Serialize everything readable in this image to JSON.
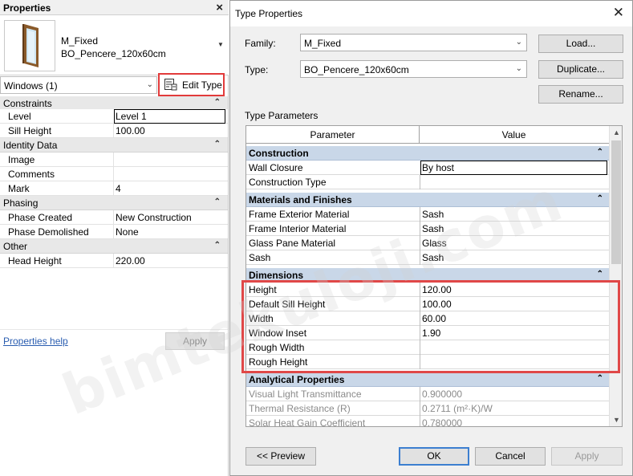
{
  "properties_panel": {
    "title": "Properties",
    "type_selector": {
      "family": "M_Fixed",
      "type": "BO_Pencere_120x60cm"
    },
    "instance_filter": "Windows (1)",
    "edit_type_label": "Edit Type",
    "rows": [
      {
        "kind": "group",
        "label": "Constraints"
      },
      {
        "kind": "param",
        "name": "Level",
        "value": "Level 1",
        "editing": true
      },
      {
        "kind": "param",
        "name": "Sill Height",
        "value": "100.00"
      },
      {
        "kind": "group",
        "label": "Identity Data"
      },
      {
        "kind": "param",
        "name": "Image",
        "value": ""
      },
      {
        "kind": "param",
        "name": "Comments",
        "value": ""
      },
      {
        "kind": "param",
        "name": "Mark",
        "value": "4"
      },
      {
        "kind": "group",
        "label": "Phasing"
      },
      {
        "kind": "param",
        "name": "Phase Created",
        "value": "New Construction"
      },
      {
        "kind": "param",
        "name": "Phase Demolished",
        "value": "None"
      },
      {
        "kind": "group",
        "label": "Other"
      },
      {
        "kind": "param",
        "name": "Head Height",
        "value": "220.00"
      }
    ],
    "help_link": "Properties help",
    "apply_label": "Apply"
  },
  "type_properties_dialog": {
    "title": "Type Properties",
    "family_label": "Family:",
    "family_value": "M_Fixed",
    "type_label": "Type:",
    "type_value": "BO_Pencere_120x60cm",
    "load_label": "Load...",
    "duplicate_label": "Duplicate...",
    "rename_label": "Rename...",
    "type_parameters_label": "Type Parameters",
    "columns": {
      "parameter": "Parameter",
      "value": "Value"
    },
    "rows": [
      {
        "kind": "group",
        "label": "Construction"
      },
      {
        "kind": "param",
        "name": "Wall Closure",
        "value": "By host",
        "editing": true
      },
      {
        "kind": "param",
        "name": "Construction Type",
        "value": ""
      },
      {
        "kind": "group",
        "label": "Materials and Finishes"
      },
      {
        "kind": "param",
        "name": "Frame Exterior Material",
        "value": "Sash"
      },
      {
        "kind": "param",
        "name": "Frame Interior Material",
        "value": "Sash"
      },
      {
        "kind": "param",
        "name": "Glass Pane Material",
        "value": "Glass"
      },
      {
        "kind": "param",
        "name": "Sash",
        "value": "Sash"
      },
      {
        "kind": "group",
        "label": "Dimensions"
      },
      {
        "kind": "param",
        "name": "Height",
        "value": "120.00"
      },
      {
        "kind": "param",
        "name": "Default Sill Height",
        "value": "100.00"
      },
      {
        "kind": "param",
        "name": "Width",
        "value": "60.00"
      },
      {
        "kind": "param",
        "name": "Window Inset",
        "value": "1.90"
      },
      {
        "kind": "param",
        "name": "Rough Width",
        "value": ""
      },
      {
        "kind": "param",
        "name": "Rough Height",
        "value": ""
      },
      {
        "kind": "group",
        "label": "Analytical Properties"
      },
      {
        "kind": "param",
        "name": "Visual Light Transmittance",
        "value": "0.900000",
        "disabled": true
      },
      {
        "kind": "param",
        "name": "Thermal Resistance (R)",
        "value": "0.2711 (m²·K)/W",
        "disabled": true
      },
      {
        "kind": "param",
        "name": "Solar Heat Gain Coefficient",
        "value": "0.780000",
        "disabled": true
      }
    ],
    "preview_label": "<< Preview",
    "ok_label": "OK",
    "cancel_label": "Cancel",
    "apply_label": "Apply"
  },
  "watermark": "bimtekuloji.com",
  "colors": {
    "highlight_frame": "#e04848",
    "group_header_bg": "#c9d7e8",
    "link": "#2a5db0",
    "default_button_border": "#3c7fd0"
  },
  "icons": [
    "close-icon",
    "window-thumbnail-icon",
    "edit-type-icon",
    "chevron-down-icon",
    "collapse-icon",
    "scroll-up-icon",
    "scroll-down-icon"
  ]
}
